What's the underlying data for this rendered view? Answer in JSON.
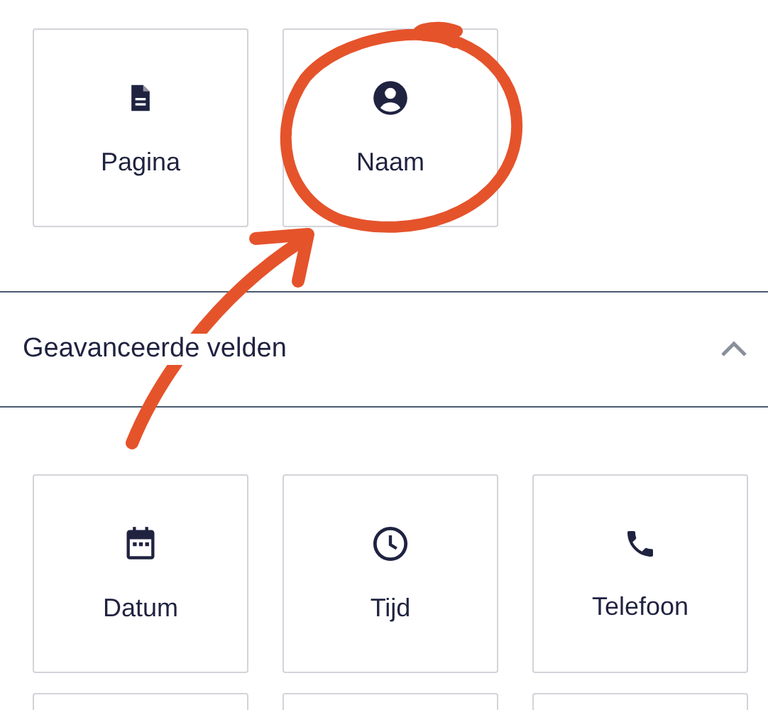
{
  "standard_fields": [
    {
      "kind": "document",
      "label": "Pagina"
    },
    {
      "kind": "person",
      "label": "Naam"
    }
  ],
  "section": {
    "title": "Geavanceerde velden",
    "expanded": true
  },
  "advanced_fields": [
    {
      "kind": "calendar",
      "label": "Datum"
    },
    {
      "kind": "clock",
      "label": "Tijd"
    },
    {
      "kind": "phone",
      "label": "Telefoon"
    }
  ]
}
